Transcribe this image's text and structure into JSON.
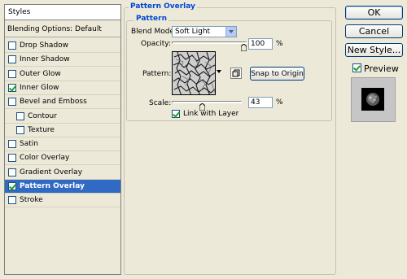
{
  "styles_panel": {
    "header": "Styles",
    "blending_options": "Blending Options: Default",
    "items": [
      {
        "label": "Drop Shadow",
        "checked": false,
        "indent": false,
        "selected": false
      },
      {
        "label": "Inner Shadow",
        "checked": false,
        "indent": false,
        "selected": false
      },
      {
        "label": "Outer Glow",
        "checked": false,
        "indent": false,
        "selected": false
      },
      {
        "label": "Inner Glow",
        "checked": true,
        "indent": false,
        "selected": false
      },
      {
        "label": "Bevel and Emboss",
        "checked": false,
        "indent": false,
        "selected": false
      },
      {
        "label": "Contour",
        "checked": false,
        "indent": true,
        "selected": false
      },
      {
        "label": "Texture",
        "checked": false,
        "indent": true,
        "selected": false
      },
      {
        "label": "Satin",
        "checked": false,
        "indent": false,
        "selected": false
      },
      {
        "label": "Color Overlay",
        "checked": false,
        "indent": false,
        "selected": false
      },
      {
        "label": "Gradient Overlay",
        "checked": false,
        "indent": false,
        "selected": false
      },
      {
        "label": "Pattern Overlay",
        "checked": true,
        "indent": false,
        "selected": true
      },
      {
        "label": "Stroke",
        "checked": false,
        "indent": false,
        "selected": false
      }
    ]
  },
  "pattern_overlay": {
    "group_title": "Pattern Overlay",
    "subgroup_title": "Pattern",
    "blend_mode_label": "Blend Mode:",
    "blend_mode_value": "Soft Light",
    "opacity_label": "Opacity:",
    "opacity_value": "100",
    "opacity_level": 1.0,
    "opacity_unit": "%",
    "pattern_label": "Pattern:",
    "snap_button": "Snap to Origin",
    "scale_label": "Scale:",
    "scale_value": "43",
    "scale_level": 0.43,
    "scale_unit": "%",
    "link_label": "Link with Layer",
    "link_checked": true
  },
  "buttons": {
    "ok": "OK",
    "cancel": "Cancel",
    "new_style": "New Style...",
    "preview_label": "Preview",
    "preview_checked": true
  },
  "colors": {
    "dialog_bg": "#ece9d8",
    "selected_bg": "#316ac5",
    "legend_blue": "#0046d5",
    "check_green": "#21a121"
  },
  "icons": {
    "dropdown": "chevron-down-icon",
    "new_preset": "new-preset-icon"
  }
}
